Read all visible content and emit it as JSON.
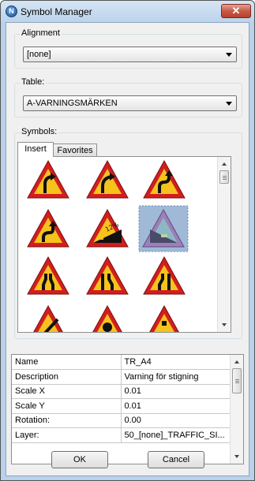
{
  "window": {
    "title": "Symbol Manager",
    "app_icon_letter": "N",
    "close_glyph": "✕"
  },
  "alignment": {
    "label": "Alignment",
    "value": "[none]"
  },
  "table": {
    "label": "Table:",
    "value": "A-VARNINGSMÄRKEN"
  },
  "symbols": {
    "label": "Symbols:",
    "tabs": [
      {
        "label": "Insert",
        "active": true
      },
      {
        "label": "Favorites",
        "active": false
      }
    ]
  },
  "properties": [
    {
      "key": "Name",
      "value": "TR_A4"
    },
    {
      "key": "Description",
      "value": "Varning för stigning"
    },
    {
      "key": "Scale X",
      "value": "0.01"
    },
    {
      "key": "Scale Y",
      "value": "0.01"
    },
    {
      "key": "Rotation:",
      "value": "0.00"
    },
    {
      "key": "Layer:",
      "value": "50_[none]_TRAFFIC_SI..."
    }
  ],
  "sign_text": {
    "grade": "12%"
  },
  "buttons": {
    "ok": "OK",
    "cancel": "Cancel"
  }
}
